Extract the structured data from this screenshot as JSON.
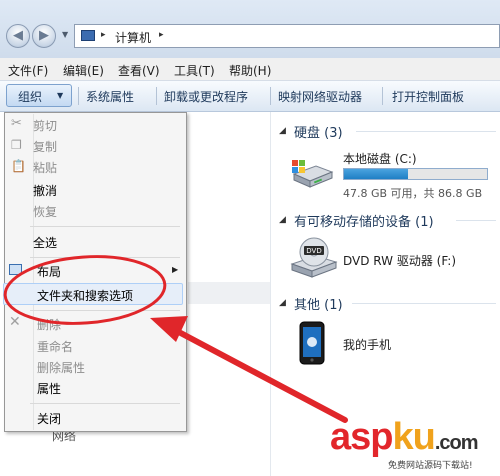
{
  "address": {
    "location": "计算机",
    "arrow_forward": "▸",
    "arrow_after": "▸"
  },
  "menubar": [
    "文件(F)",
    "编辑(E)",
    "查看(V)",
    "工具(T)",
    "帮助(H)"
  ],
  "toolbar": {
    "organize": "组织",
    "items": [
      "系统属性",
      "卸载或更改程序",
      "映射网络驱动器",
      "打开控制面板"
    ]
  },
  "groups": {
    "hard_disks": {
      "title": "硬盘 (3)"
    },
    "removable": {
      "title": "有可移动存储的设备 (1)"
    },
    "other": {
      "title": "其他 (1)"
    }
  },
  "drives": {
    "local_c": {
      "name": "本地磁盘 (C:)",
      "space": "47.8 GB 可用，共 86.8 GB",
      "used_fraction": 0.45
    },
    "dvd": {
      "name": "DVD RW 驱动器 (F:)"
    },
    "phone": {
      "name": "我的手机"
    }
  },
  "context_menu": {
    "cut": "剪切",
    "copy": "复制",
    "paste": "粘贴",
    "undo": "撤消",
    "redo": "恢复",
    "select_all": "全选",
    "layout": "布局",
    "folder_options": "文件夹和搜索选项",
    "delete": "删除",
    "rename": "重命名",
    "remove_props": "删除属性",
    "properties": "属性",
    "close": "关闭"
  },
  "watermark": {
    "asp": "asp",
    "ku": "ku",
    "dotcom": ".com",
    "tagline": "免费网站源码下载站!"
  },
  "colors": {
    "highlight_circle": "#e0262a",
    "arrow": "#e0262a",
    "drive_fill": "#1f7fc4"
  }
}
